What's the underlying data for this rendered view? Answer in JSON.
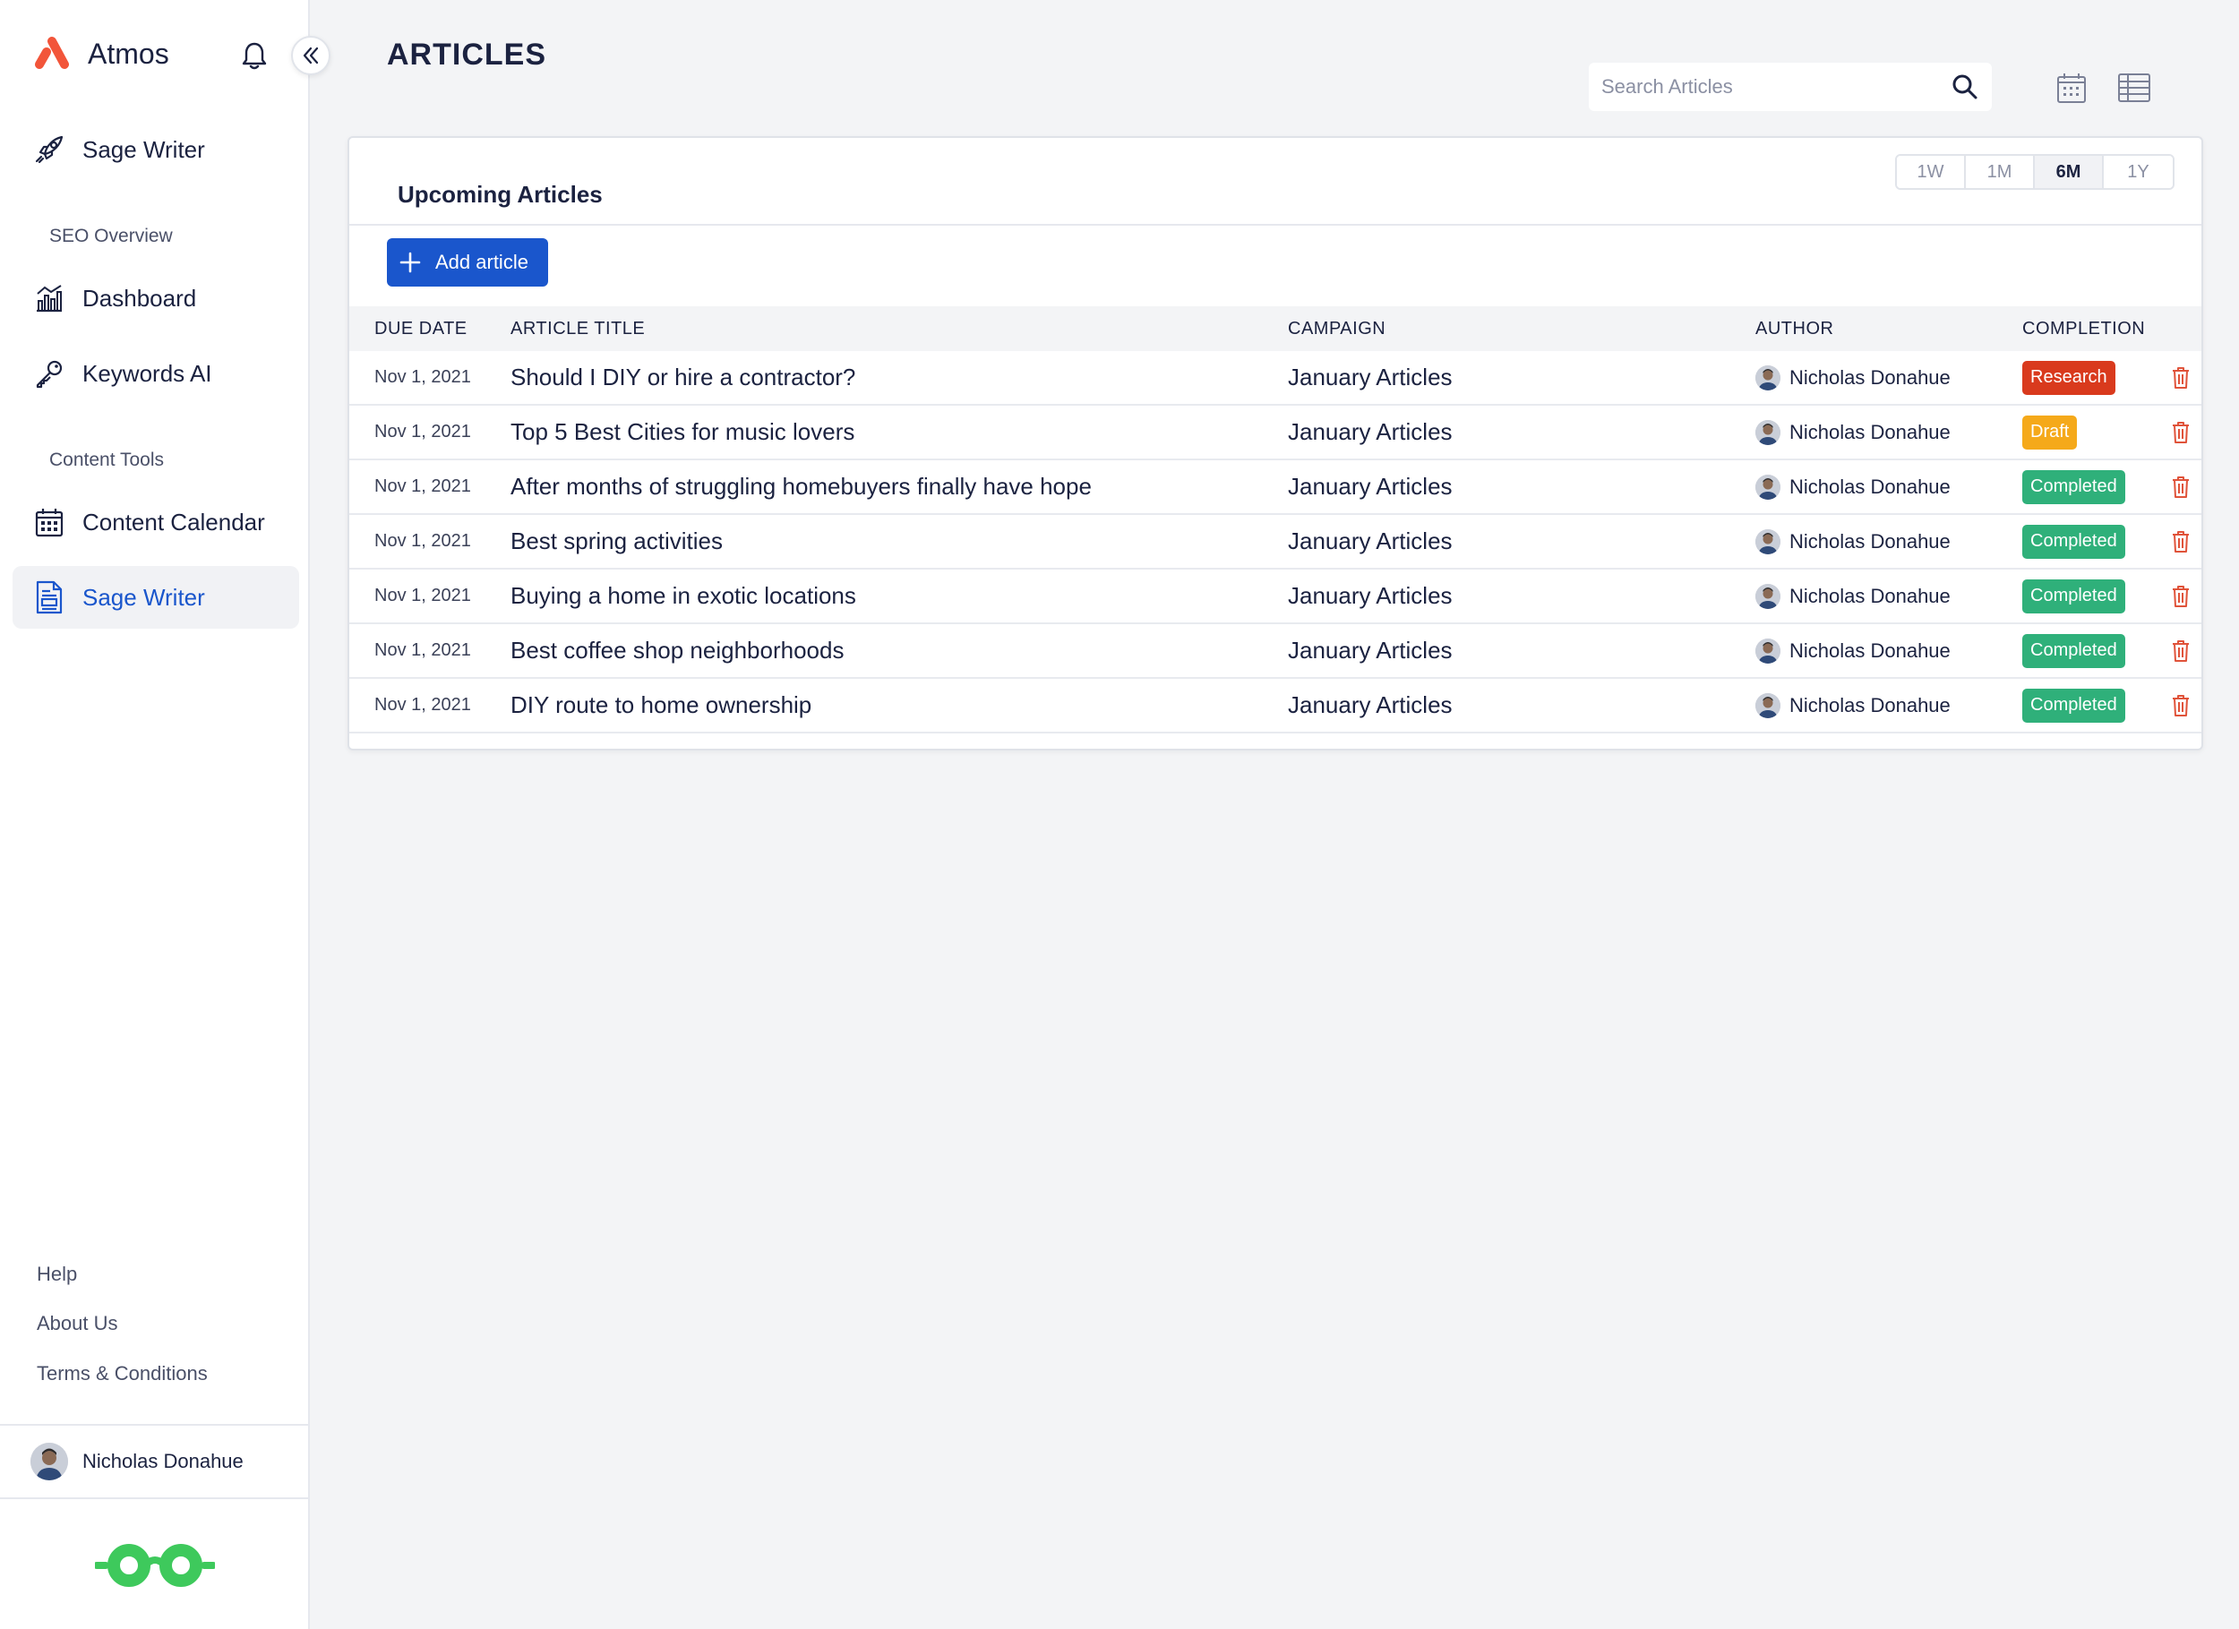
{
  "app": {
    "name": "Atmos"
  },
  "sidebar": {
    "top_item": {
      "label": "Sage Writer",
      "icon": "rocket-icon"
    },
    "sections": [
      {
        "label": "SEO Overview",
        "items": [
          {
            "label": "Dashboard",
            "icon": "chart-icon"
          },
          {
            "label": "Keywords AI",
            "icon": "key-icon"
          }
        ]
      },
      {
        "label": "Content Tools",
        "items": [
          {
            "label": "Content Calendar",
            "icon": "calendar-icon"
          },
          {
            "label": "Sage Writer",
            "icon": "document-icon",
            "active": true
          }
        ]
      }
    ],
    "footer_links": [
      "Help",
      "About Us",
      "Terms & Conditions"
    ],
    "user": {
      "name": "Nicholas Donahue"
    }
  },
  "header": {
    "title": "ARTICLES",
    "search_placeholder": "Search Articles"
  },
  "card": {
    "title": "Upcoming Articles",
    "ranges": [
      "1W",
      "1M",
      "6M",
      "1Y"
    ],
    "selected_range": "6M",
    "add_button": "Add article",
    "columns": [
      "DUE DATE",
      "ARTICLE TITLE",
      "CAMPAIGN",
      "AUTHOR",
      "COMPLETION"
    ],
    "rows": [
      {
        "date": "Nov 1, 2021",
        "title": "Should I DIY or hire a contractor?",
        "campaign": "January Articles",
        "author": "Nicholas Donahue",
        "status": "Research"
      },
      {
        "date": "Nov 1, 2021",
        "title": "Top 5 Best Cities for music lovers",
        "campaign": "January Articles",
        "author": "Nicholas Donahue",
        "status": "Draft"
      },
      {
        "date": "Nov 1, 2021",
        "title": "After months of struggling homebuyers finally have hope",
        "campaign": "January Articles",
        "author": "Nicholas Donahue",
        "status": "Completed"
      },
      {
        "date": "Nov 1, 2021",
        "title": "Best spring activities",
        "campaign": "January Articles",
        "author": "Nicholas Donahue",
        "status": "Completed"
      },
      {
        "date": "Nov 1, 2021",
        "title": "Buying a home in exotic locations",
        "campaign": "January Articles",
        "author": "Nicholas Donahue",
        "status": "Completed"
      },
      {
        "date": "Nov 1, 2021",
        "title": "Best coffee shop neighborhoods",
        "campaign": "January Articles",
        "author": "Nicholas Donahue",
        "status": "Completed"
      },
      {
        "date": "Nov 1, 2021",
        "title": "DIY route to home ownership",
        "campaign": "January Articles",
        "author": "Nicholas Donahue",
        "status": "Completed"
      }
    ]
  },
  "colors": {
    "accent": "#1a56cc",
    "research": "#d93a1d",
    "draft": "#f5a91a",
    "completed": "#2fb07a",
    "trash": "#e0533a",
    "logo": "#f2553a",
    "brand_glasses": "#3ec95c"
  }
}
